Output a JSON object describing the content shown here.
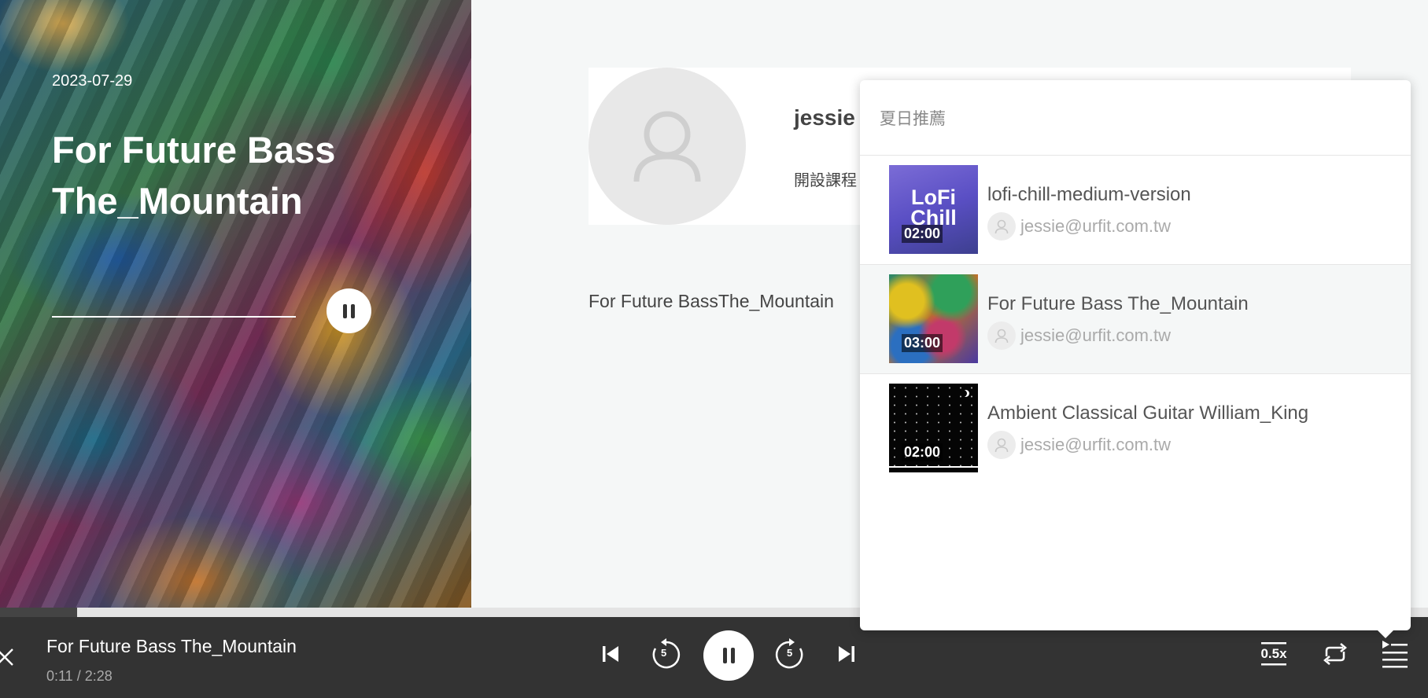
{
  "hero": {
    "date": "2023-07-29",
    "title": "For Future Bass The_Mountain",
    "play_state": "pause-icon"
  },
  "profile": {
    "name": "jessie",
    "course_label": "開設課程",
    "avatar_icon": "user-icon"
  },
  "track_text": "For Future BassThe_Mountain",
  "playlist": {
    "title": "夏日推薦",
    "items": [
      {
        "title": "lofi-chill-medium-version",
        "duration": "02:00",
        "author": "jessie@urfit.com.tw",
        "thumb_text": "LoFi Chill",
        "active": false
      },
      {
        "title": "For Future Bass The_Mountain",
        "duration": "03:00",
        "author": "jessie@urfit.com.tw",
        "active": true
      },
      {
        "title": "Ambient Classical Guitar William_King",
        "duration": "02:00",
        "author": "jessie@urfit.com.tw",
        "active": false
      }
    ]
  },
  "player": {
    "title": "For Future Bass The_Mountain",
    "current_time": "0:11",
    "separator": "/",
    "total_time": "2:28",
    "progress_fraction": 0.054,
    "skip_back_seconds": "5",
    "skip_forward_seconds": "5",
    "speed": "0.5x",
    "icons": {
      "close": "close-icon",
      "prev": "skip-previous-icon",
      "rewind": "rewind-5-icon",
      "play": "pause-icon",
      "forward": "forward-5-icon",
      "next": "skip-next-icon",
      "speed": "speed-icon",
      "repeat": "repeat-icon",
      "playlist": "playlist-icon"
    }
  },
  "colors": {
    "player_bg": "#333333",
    "page_bg": "#f5f7f7",
    "text_muted": "#aaaaaa"
  }
}
